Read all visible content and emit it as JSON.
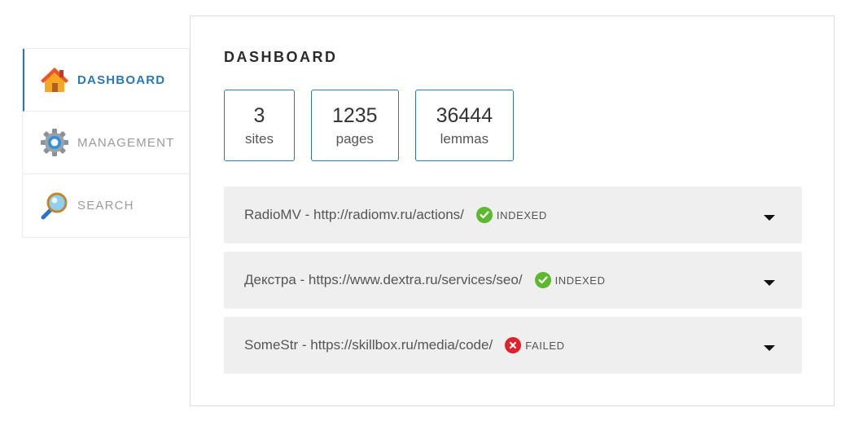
{
  "sidebar": {
    "items": [
      {
        "label": "DASHBOARD",
        "icon": "home-icon",
        "active": true
      },
      {
        "label": "MANAGEMENT",
        "icon": "gear-icon",
        "active": false
      },
      {
        "label": "SEARCH",
        "icon": "magnifier-icon",
        "active": false
      }
    ]
  },
  "dashboard": {
    "title": "DASHBOARD",
    "stats": [
      {
        "value": "3",
        "label": "sites"
      },
      {
        "value": "1235",
        "label": "pages"
      },
      {
        "value": "36444",
        "label": "lemmas"
      }
    ],
    "sites": [
      {
        "name": "RadioMV - http://radiomv.ru/actions/",
        "status": "INDEXED",
        "status_color": "#5cb82e"
      },
      {
        "name": "Декстра - https://www.dextra.ru/services/seo/",
        "status": "INDEXED",
        "status_color": "#5cb82e"
      },
      {
        "name": "SomeStr - https://skillbox.ru/media/code/",
        "status": "FAILED",
        "status_color": "#e0202a"
      }
    ]
  },
  "colors": {
    "accent": "#2a78b5",
    "row_bg": "#efefef"
  }
}
